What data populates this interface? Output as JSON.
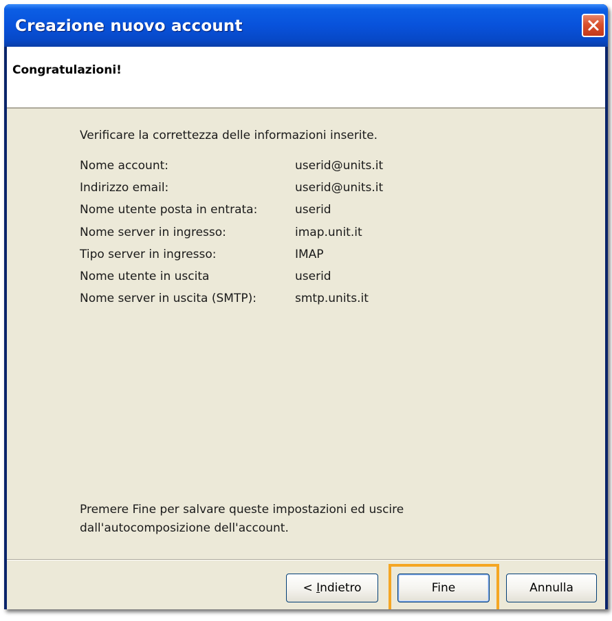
{
  "window": {
    "title": "Creazione nuovo account"
  },
  "header": {
    "title": "Congratulazioni!"
  },
  "main": {
    "intro": "Verificare la correttezza delle informazioni inserite.",
    "rows": [
      {
        "label": "Nome account:",
        "value": "userid@units.it"
      },
      {
        "label": "Indirizzo email:",
        "value": "userid@units.it"
      },
      {
        "label": "Nome utente posta in entrata:",
        "value": "userid"
      },
      {
        "label": "Nome server in ingresso:",
        "value": "imap.unit.it"
      },
      {
        "label": "Tipo server in ingresso:",
        "value": "IMAP"
      },
      {
        "label": "Nome utente in uscita",
        "value": "userid"
      },
      {
        "label": "Nome server in uscita (SMTP):",
        "value": "smtp.units.it"
      }
    ],
    "footer_line1": "Premere Fine per salvare queste impostazioni ed uscire",
    "footer_line2": "dall'autocomposizione dell'account."
  },
  "buttons": {
    "back_prefix": "< ",
    "back_mnemonic": "I",
    "back_rest": "ndietro",
    "finish": "Fine",
    "cancel": "Annulla"
  },
  "colors": {
    "titlebar": "#0852db",
    "dialog_bg": "#ece9d8",
    "highlight": "#f5a623",
    "close_button": "#d9512c"
  },
  "icons": {
    "close": "close-icon"
  }
}
